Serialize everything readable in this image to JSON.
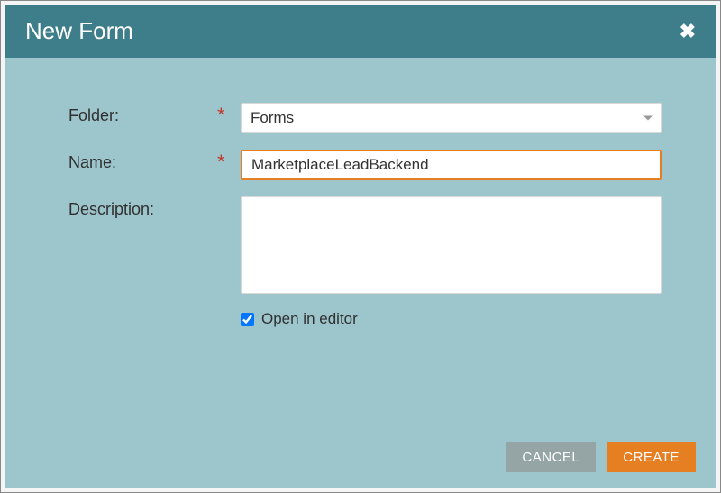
{
  "dialog": {
    "title": "New Form"
  },
  "form": {
    "folder": {
      "label": "Folder:",
      "value": "Forms",
      "required": "*"
    },
    "name": {
      "label": "Name:",
      "value": "MarketplaceLeadBackend",
      "required": "*"
    },
    "description": {
      "label": "Description:",
      "value": ""
    },
    "openInEditor": {
      "label": "Open in editor",
      "checked": true
    }
  },
  "buttons": {
    "cancel": "CANCEL",
    "create": "CREATE"
  }
}
